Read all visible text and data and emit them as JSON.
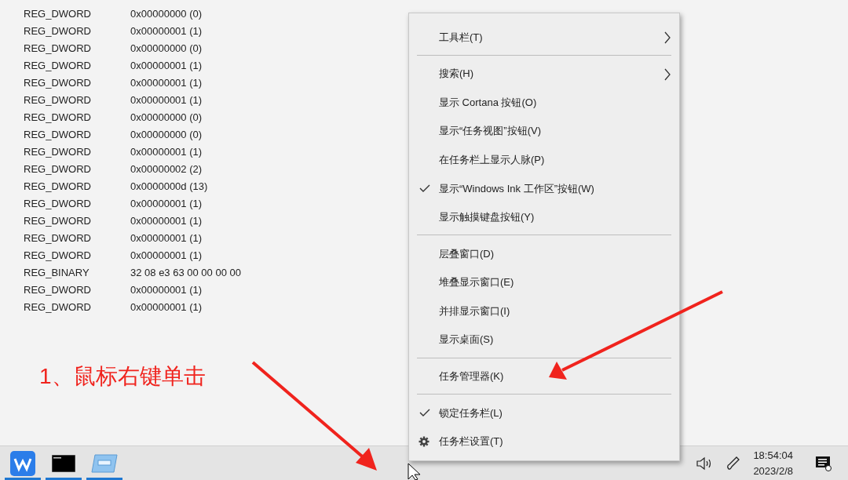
{
  "registry_values": [
    {
      "type": "REG_DWORD",
      "data": "0x00000000 (0)"
    },
    {
      "type": "REG_DWORD",
      "data": "0x00000001 (1)"
    },
    {
      "type": "REG_DWORD",
      "data": "0x00000000 (0)"
    },
    {
      "type": "REG_DWORD",
      "data": "0x00000001 (1)"
    },
    {
      "type": "REG_DWORD",
      "data": "0x00000001 (1)"
    },
    {
      "type": "REG_DWORD",
      "data": "0x00000001 (1)"
    },
    {
      "type": "REG_DWORD",
      "data": "0x00000000 (0)"
    },
    {
      "type": "REG_DWORD",
      "data": "0x00000000 (0)"
    },
    {
      "type": "REG_DWORD",
      "data": "0x00000001 (1)"
    },
    {
      "type": "REG_DWORD",
      "data": "0x00000002 (2)"
    },
    {
      "type": "REG_DWORD",
      "data": "0x0000000d (13)"
    },
    {
      "type": "REG_DWORD",
      "data": "0x00000001 (1)"
    },
    {
      "type": "REG_DWORD",
      "data": "0x00000001 (1)"
    },
    {
      "type": "REG_DWORD",
      "data": "0x00000001 (1)"
    },
    {
      "type": "REG_DWORD",
      "data": "0x00000001 (1)"
    },
    {
      "type": "REG_BINARY",
      "data": "32 08 e3 63 00 00 00 00"
    },
    {
      "type": "REG_DWORD",
      "data": "0x00000001 (1)"
    },
    {
      "type": "REG_DWORD",
      "data": "0x00000001 (1)"
    }
  ],
  "annotation": {
    "text": "1、鼠标右键单击"
  },
  "context_menu": {
    "items": [
      {
        "kind": "item",
        "label": "工具栏(T)",
        "checked": false,
        "submenu": true
      },
      {
        "kind": "separator"
      },
      {
        "kind": "item",
        "label": "搜索(H)",
        "checked": false,
        "submenu": true
      },
      {
        "kind": "item",
        "label": "显示 Cortana 按钮(O)",
        "checked": false,
        "submenu": false
      },
      {
        "kind": "item",
        "label": "显示“任务视图”按钮(V)",
        "checked": false,
        "submenu": false
      },
      {
        "kind": "item",
        "label": "在任务栏上显示人脉(P)",
        "checked": false,
        "submenu": false
      },
      {
        "kind": "item",
        "label": "显示“Windows Ink 工作区”按钮(W)",
        "checked": true,
        "submenu": false
      },
      {
        "kind": "item",
        "label": "显示触摸键盘按钮(Y)",
        "checked": false,
        "submenu": false
      },
      {
        "kind": "separator"
      },
      {
        "kind": "item",
        "label": "层叠窗口(D)",
        "checked": false,
        "submenu": false
      },
      {
        "kind": "item",
        "label": "堆叠显示窗口(E)",
        "checked": false,
        "submenu": false
      },
      {
        "kind": "item",
        "label": "并排显示窗口(I)",
        "checked": false,
        "submenu": false
      },
      {
        "kind": "item",
        "label": "显示桌面(S)",
        "checked": false,
        "submenu": false
      },
      {
        "kind": "separator"
      },
      {
        "kind": "item",
        "label": "任务管理器(K)",
        "checked": false,
        "submenu": false
      },
      {
        "kind": "separator"
      },
      {
        "kind": "item",
        "label": "锁定任务栏(L)",
        "checked": true,
        "submenu": false
      },
      {
        "kind": "settings",
        "label": "任务栏设置(T)",
        "checked": false,
        "submenu": false
      }
    ]
  },
  "taskbar": {
    "apps": [
      {
        "kind": "wps"
      },
      {
        "kind": "terminal"
      },
      {
        "kind": "window"
      }
    ],
    "tray": {
      "time": "18:54:04",
      "date": "2023/2/8"
    }
  }
}
